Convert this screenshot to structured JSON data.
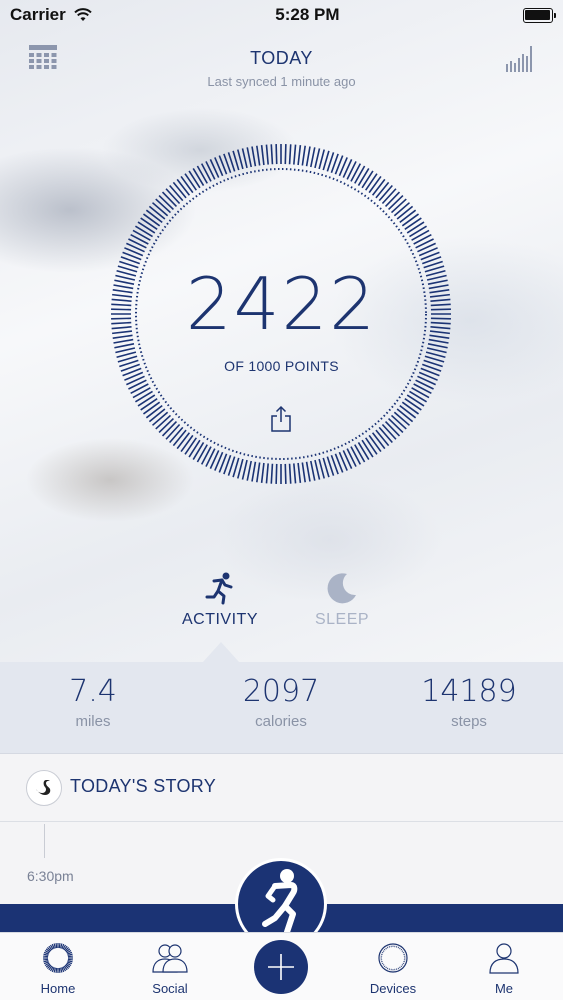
{
  "status_bar": {
    "carrier": "Carrier",
    "time": "5:28 PM"
  },
  "header": {
    "title": "TODAY",
    "subtitle": "Last synced 1 minute ago"
  },
  "score": {
    "value": "2422",
    "caption": "OF 1000 POINTS"
  },
  "modes": [
    {
      "label": "ACTIVITY",
      "icon": "running-person-icon",
      "active": true
    },
    {
      "label": "SLEEP",
      "icon": "moon-icon",
      "active": false
    }
  ],
  "stats": [
    {
      "value": "7.4",
      "unit": "miles"
    },
    {
      "value": "2097",
      "unit": "calories"
    },
    {
      "value": "14189",
      "unit": "steps"
    }
  ],
  "story": {
    "title": "TODAY'S STORY",
    "first_time": "6:30pm"
  },
  "tabbar": {
    "items": [
      {
        "label": "Home",
        "icon": "home-ring-icon"
      },
      {
        "label": "Social",
        "icon": "people-icon"
      },
      {
        "label": "",
        "icon": "plus-icon"
      },
      {
        "label": "Devices",
        "icon": "device-icon"
      },
      {
        "label": "Me",
        "icon": "person-icon"
      }
    ]
  },
  "colors": {
    "brand_navy": "#1b3374",
    "text_navy": "#1d3470",
    "muted": "#8a93a6",
    "inactive": "#aab3c6"
  }
}
